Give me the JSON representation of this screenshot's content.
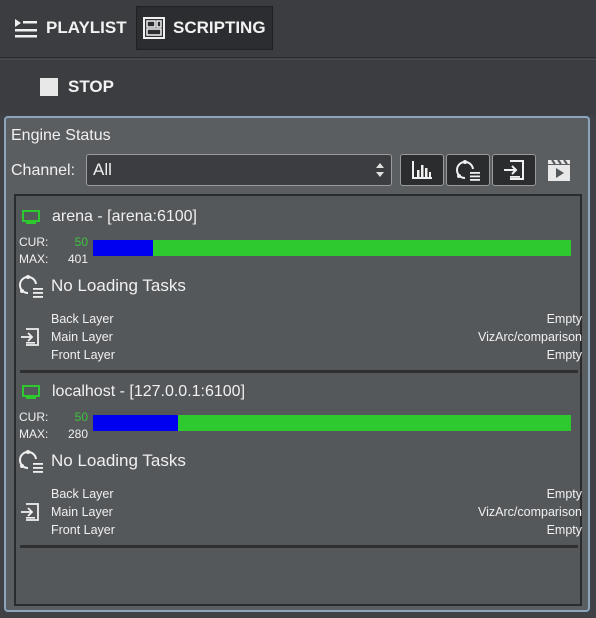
{
  "tabs": [
    {
      "label": "PLAYLIST",
      "icon": "playlist-icon",
      "active": false
    },
    {
      "label": "SCRIPTING",
      "icon": "scripting-icon",
      "active": true
    }
  ],
  "stop": {
    "label": "STOP",
    "icon": "stop-square-icon"
  },
  "engine_status": {
    "title": "Engine Status",
    "channel_label": "Channel:",
    "channel_value": "All",
    "toolbar_icons": [
      "chart-icon",
      "refresh-loading-icon",
      "login-import-icon",
      "clapperboard-play-icon"
    ],
    "engines": [
      {
        "name": "arena - [arena:6100]",
        "cur_label": "CUR:",
        "cur_value": "50",
        "max_label": "MAX:",
        "max_value": "401",
        "loading_text": "No Loading Tasks",
        "layers": [
          {
            "name": "Back Layer",
            "value": "Empty"
          },
          {
            "name": "Main Layer",
            "value": "VizArc/comparison"
          },
          {
            "name": "Front Layer",
            "value": "Empty"
          }
        ]
      },
      {
        "name": "localhost - [127.0.0.1:6100]",
        "cur_label": "CUR:",
        "cur_value": "50",
        "max_label": "MAX:",
        "max_value": "280",
        "loading_text": "No Loading Tasks",
        "layers": [
          {
            "name": "Back Layer",
            "value": "Empty"
          },
          {
            "name": "Main Layer",
            "value": "VizArc/comparison"
          },
          {
            "name": "Front Layer",
            "value": "Empty"
          }
        ]
      }
    ]
  },
  "colors": {
    "bar_used": "#0000f0",
    "bar_free": "#2ec92e",
    "cur_value": "#3cc43c",
    "panel_border": "#8aa6bf"
  }
}
